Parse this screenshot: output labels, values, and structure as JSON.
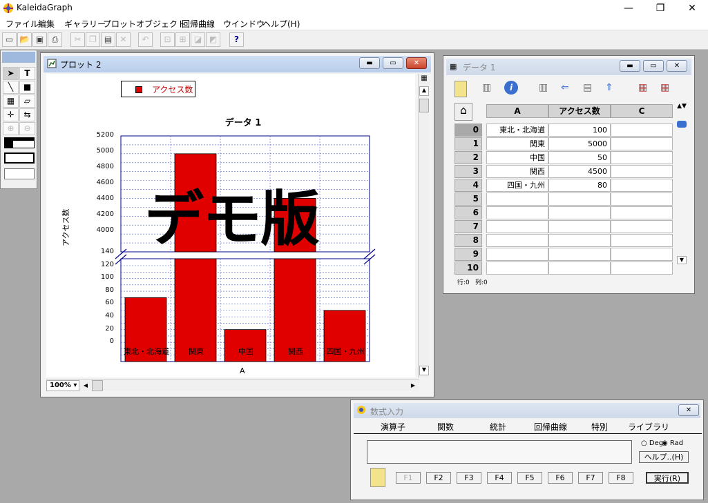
{
  "app": {
    "title": "KaleidaGraph",
    "min": "—",
    "max": "❐",
    "close": "✕"
  },
  "menu": [
    "ファイル",
    "編集",
    "ギャラリー",
    "プロット",
    "オブジェクト",
    "回帰曲線",
    "ウインドウ",
    "ヘルプ(H)"
  ],
  "toolbar": {
    "help_label": "?"
  },
  "plot_window": {
    "title": "プロット 2",
    "legend_label": "アクセス数",
    "chart_title": "データ 1",
    "ylabel": "アクセス数",
    "xlabel": "A",
    "watermark": "デモ版",
    "zoom": "100%",
    "yticks_upper": [
      "5200",
      "5000",
      "4800",
      "4600",
      "4400",
      "4200",
      "4000"
    ],
    "yticks_lower": [
      "140",
      "120",
      "100",
      "80",
      "60",
      "40",
      "20",
      "0"
    ]
  },
  "chart_data": {
    "type": "bar",
    "title": "データ 1",
    "xlabel": "A",
    "ylabel": "アクセス数",
    "categories": [
      "東北・北海道",
      "関東",
      "中国",
      "関西",
      "四国・九州"
    ],
    "series": [
      {
        "name": "アクセス数",
        "values": [
          100,
          5000,
          50,
          4500,
          80
        ],
        "color": "#e00000"
      }
    ],
    "y_break": {
      "lower_range": [
        0,
        150
      ],
      "upper_range": [
        3900,
        5200
      ]
    },
    "grid": true,
    "legend": "top-left"
  },
  "data_window": {
    "title": "データ 1",
    "col_headers": [
      "A",
      "アクセス数",
      "C"
    ],
    "rows": [
      {
        "idx": "0",
        "a": "東北・北海道",
        "b": "100"
      },
      {
        "idx": "1",
        "a": "関東",
        "b": "5000"
      },
      {
        "idx": "2",
        "a": "中国",
        "b": "50"
      },
      {
        "idx": "3",
        "a": "関西",
        "b": "4500"
      },
      {
        "idx": "4",
        "a": "四国・九州",
        "b": "80"
      },
      {
        "idx": "5",
        "a": "",
        "b": ""
      },
      {
        "idx": "6",
        "a": "",
        "b": ""
      },
      {
        "idx": "7",
        "a": "",
        "b": ""
      },
      {
        "idx": "8",
        "a": "",
        "b": ""
      },
      {
        "idx": "9",
        "a": "",
        "b": ""
      },
      {
        "idx": "10",
        "a": "",
        "b": ""
      }
    ],
    "status_row": "行:0",
    "status_col": "列:0"
  },
  "formula_window": {
    "title": "数式入力",
    "tabs": [
      "演算子",
      "関数",
      "統計",
      "回帰曲線",
      "特別",
      "ライブラリ"
    ],
    "deg_label": "Deg",
    "rad_label": "Rad",
    "help_button": "ヘルプ..(H)",
    "fkeys": [
      "F1",
      "F2",
      "F3",
      "F4",
      "F5",
      "F6",
      "F7",
      "F8"
    ],
    "run_button": "実行(R)"
  }
}
